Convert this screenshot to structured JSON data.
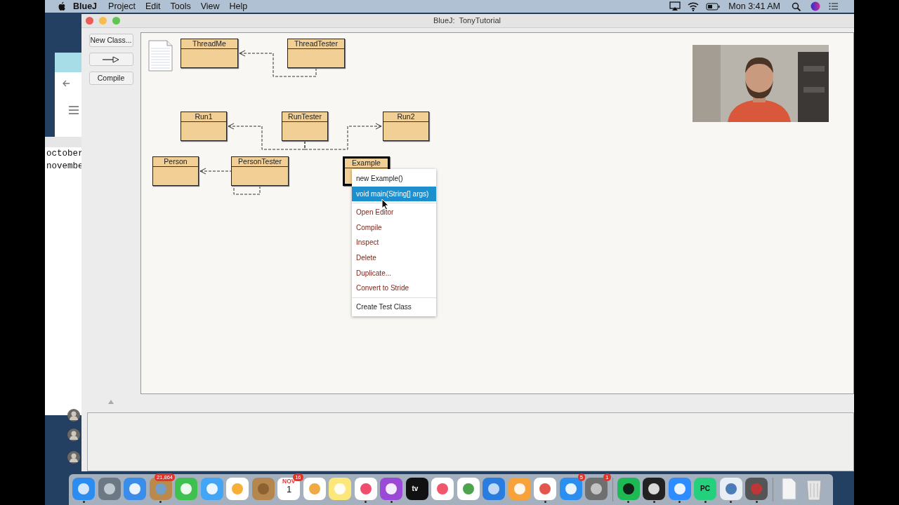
{
  "menubar": {
    "app": "BlueJ",
    "items": [
      "Project",
      "Edit",
      "Tools",
      "View",
      "Help"
    ],
    "clock": "Mon 3:41 AM"
  },
  "background_window": {
    "lines": [
      "october",
      "novembe"
    ]
  },
  "window": {
    "title": "BlueJ:  TonyTutorial",
    "toolbar": [
      {
        "kind": "text",
        "label": "New Class..."
      },
      {
        "kind": "arrow"
      },
      {
        "kind": "text",
        "label": "Compile"
      }
    ],
    "classes": [
      {
        "name": "ThreadMe",
        "selected": false
      },
      {
        "name": "ThreadTester",
        "selected": false
      },
      {
        "name": "Run1",
        "selected": false
      },
      {
        "name": "RunTester",
        "selected": false
      },
      {
        "name": "Run2",
        "selected": false
      },
      {
        "name": "Person",
        "selected": false
      },
      {
        "name": "PersonTester",
        "selected": false
      },
      {
        "name": "Example",
        "selected": true
      }
    ],
    "context_menu": {
      "groups": [
        {
          "items": [
            {
              "label": "new Example()",
              "kind": "call",
              "selected": false
            },
            {
              "label": "void main(String[] args)",
              "kind": "call",
              "selected": true
            }
          ]
        },
        {
          "items": [
            {
              "label": "Open Editor",
              "kind": "action",
              "selected": false
            },
            {
              "label": "Compile",
              "kind": "action",
              "selected": false
            },
            {
              "label": "Inspect",
              "kind": "action",
              "selected": false
            },
            {
              "label": "Delete",
              "kind": "action",
              "selected": false
            },
            {
              "label": "Duplicate...",
              "kind": "action",
              "selected": false
            },
            {
              "label": "Convert to Stride",
              "kind": "action",
              "selected": false
            }
          ]
        },
        {
          "items": [
            {
              "label": "Create Test Class",
              "kind": "call",
              "selected": false
            }
          ]
        }
      ]
    }
  },
  "dock": [
    {
      "kind": "finder",
      "running": true
    },
    {
      "kind": "rocket",
      "running": false
    },
    {
      "kind": "compass",
      "running": false
    },
    {
      "kind": "stamp",
      "running": true,
      "badge": "21,864"
    },
    {
      "kind": "video",
      "running": false
    },
    {
      "kind": "chat",
      "running": false
    },
    {
      "kind": "flower",
      "running": false
    },
    {
      "kind": "book",
      "running": false
    },
    {
      "kind": "calendar",
      "running": false,
      "month": "NOV",
      "day": "1",
      "badge": "16"
    },
    {
      "kind": "list",
      "running": false
    },
    {
      "kind": "notes",
      "running": false
    },
    {
      "kind": "music",
      "running": true
    },
    {
      "kind": "podcast",
      "running": true
    },
    {
      "kind": "tv",
      "running": false,
      "label": "tv"
    },
    {
      "kind": "news",
      "running": false
    },
    {
      "kind": "chart",
      "running": false
    },
    {
      "kind": "lectern",
      "running": false
    },
    {
      "kind": "pages",
      "running": false
    },
    {
      "kind": "browser",
      "running": true
    },
    {
      "kind": "store",
      "running": false,
      "badge": "5"
    },
    {
      "kind": "gear",
      "running": false,
      "badge": "1"
    },
    {
      "kind": "divider"
    },
    {
      "kind": "spotify",
      "running": true
    },
    {
      "kind": "terminal",
      "running": true
    },
    {
      "kind": "camera",
      "running": true
    },
    {
      "kind": "ide",
      "running": true,
      "label": "PC"
    },
    {
      "kind": "bird",
      "running": true
    },
    {
      "kind": "app",
      "running": true
    },
    {
      "kind": "divider"
    },
    {
      "kind": "document"
    },
    {
      "kind": "trash"
    }
  ]
}
